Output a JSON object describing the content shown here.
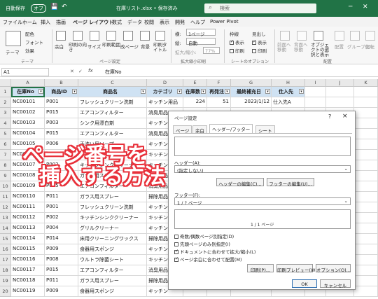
{
  "titlebar": {
    "autosave": "自動保存",
    "autosave_state": "オフ",
    "filename": "在庫リスト.xlsx • 保存済み",
    "search_placeholder": "検索",
    "accent": "#217346"
  },
  "tabs": [
    "ファイル",
    "ホーム",
    "挿入",
    "描画",
    "ページ レイアウト",
    "数式",
    "データ",
    "校閲",
    "表示",
    "開発",
    "ヘルプ",
    "Power Pivot"
  ],
  "ribbon": {
    "theme": {
      "colors": "配色",
      "fonts": "フォント",
      "effects": "効果",
      "theme_btn": "テーマ",
      "group": "テーマ"
    },
    "page_setup": {
      "margins": "余白",
      "orientation": "印刷の向き",
      "size": "サイズ",
      "print_area": "印刷範囲",
      "breaks": "改ページ",
      "background": "背景",
      "print_titles": "印刷タイトル",
      "group": "ページ設定"
    },
    "scale": {
      "width_label": "横:",
      "width_val": "1ページ",
      "height_label": "縦:",
      "height_val": "自動",
      "scale_label": "拡大/縮小:",
      "scale_val": "77%",
      "group": "拡大縮小印刷"
    },
    "sheet_options": {
      "gridlines": "枠線",
      "headings": "見出し",
      "view1": "表示",
      "view2": "表示",
      "print1": "印刷",
      "print2": "印刷",
      "group": "シートのオプション"
    },
    "arrange": {
      "forward": "前面へ移動",
      "backward": "背面へ移動",
      "selection": "オブジェクトの選択と表示",
      "align": "配置",
      "group_btn": "グループ化",
      "rotate": "回転",
      "group": "配置"
    }
  },
  "formula_bar": {
    "name_box": "A1",
    "fx": "fx",
    "value": "在庫No"
  },
  "columns": [
    "A",
    "B",
    "C",
    "D",
    "E",
    "F",
    "G",
    "H",
    "I",
    "J",
    "K"
  ],
  "headers": [
    "在庫No",
    "商品ID",
    "商品名",
    "カテゴリ",
    "在庫数",
    "再発注",
    "最終補充日",
    "仕入先"
  ],
  "rows": [
    [
      "NC00101",
      "P001",
      "フレッシュクリーン洗剤",
      "キッチン用品",
      "224",
      "51",
      "2023/1/12",
      "仕入先A"
    ],
    [
      "NC00102",
      "P015",
      "エアコンフィルター",
      "消臭用品",
      "",
      "",
      "",
      ""
    ],
    [
      "NC00103",
      "P003",
      "シンク用漂白剤",
      "キッチン",
      "",
      "",
      "",
      ""
    ],
    [
      "NC00104",
      "P015",
      "エアコンフィルター",
      "消臭用品",
      "",
      "",
      "",
      ""
    ],
    [
      "NC00105",
      "P006",
      "手洗い用ソープ",
      "キッチン",
      "",
      "",
      "",
      ""
    ],
    [
      "NC00106",
      "P002",
      "キッチンシンククリーナー",
      "キッチン",
      "",
      "",
      "",
      ""
    ],
    [
      "NC00107",
      "P002",
      "キッチンシンククリーナー",
      "キッチン",
      "",
      "",
      "",
      ""
    ],
    [
      "NC00108",
      "P011",
      "ガラス用スプレー",
      "掃除用品",
      "",
      "",
      "",
      ""
    ],
    [
      "NC00109",
      "P015",
      "エアコンフィルター",
      "消臭用品",
      "",
      "",
      "",
      ""
    ],
    [
      "NC00110",
      "P011",
      "ガラス用スプレー",
      "掃除用品",
      "",
      "",
      "",
      ""
    ],
    [
      "NC00111",
      "P001",
      "フレッシュクリーン洗剤",
      "キッチン",
      "",
      "",
      "",
      ""
    ],
    [
      "NC00112",
      "P002",
      "キッチンシンククリーナー",
      "キッチン",
      "",
      "",
      "",
      ""
    ],
    [
      "NC00113",
      "P004",
      "グリルクリーナー",
      "キッチン",
      "",
      "",
      "",
      ""
    ],
    [
      "NC00114",
      "P014",
      "床用クリーニングワックス",
      "掃除用品",
      "",
      "",
      "",
      ""
    ],
    [
      "NC00115",
      "P009",
      "食器用スポンジ",
      "キッチン",
      "",
      "",
      "",
      ""
    ],
    [
      "NC00116",
      "P008",
      "ウルトラ除菌シート",
      "キッチン",
      "",
      "",
      "",
      ""
    ],
    [
      "NC00117",
      "P015",
      "エアコンフィルター",
      "消臭用品",
      "",
      "",
      "",
      ""
    ],
    [
      "NC00118",
      "P011",
      "ガラス用スプレー",
      "掃除用品",
      "",
      "",
      "",
      ""
    ],
    [
      "NC00119",
      "P009",
      "食器用スポンジ",
      "キッチン",
      "",
      "",
      "",
      ""
    ]
  ],
  "row_numbers": [
    "1",
    "2",
    "3",
    "4",
    "5",
    "6",
    "7",
    "8",
    "9",
    "10",
    "11",
    "12",
    "13",
    "14",
    "15",
    "16",
    "17",
    "18",
    "19",
    "20"
  ],
  "dialog": {
    "title": "ページ設定",
    "help": "?",
    "close": "×",
    "tabs": [
      "ページ",
      "余白",
      "ヘッダー/フッター",
      "シート"
    ],
    "header_label": "ヘッダー(A):",
    "header_value": "(指定しない)",
    "edit_header": "ヘッダーの編集(C)...",
    "edit_footer": "フッターの編集(U)...",
    "footer_label": "フッター(F):",
    "footer_value": "1 / ? ページ",
    "footer_preview": "1 / 1 ページ",
    "checks": [
      {
        "label": "奇数/偶数ページ別指定(D)",
        "checked": false
      },
      {
        "label": "先頭ページのみ別指定(I)",
        "checked": false
      },
      {
        "label": "ドキュメントに合わせて拡大/縮小(L)",
        "checked": true
      },
      {
        "label": "ページ余白に合わせて配置(M)",
        "checked": true
      }
    ],
    "print": "印刷(P)...",
    "preview": "印刷プレビュー(W)",
    "options": "オプション(O)...",
    "ok": "OK",
    "cancel": "キャンセル"
  },
  "overlay": {
    "line1": "ページ番号を",
    "line2": "挿入する方法",
    "color": "#e8303a"
  }
}
